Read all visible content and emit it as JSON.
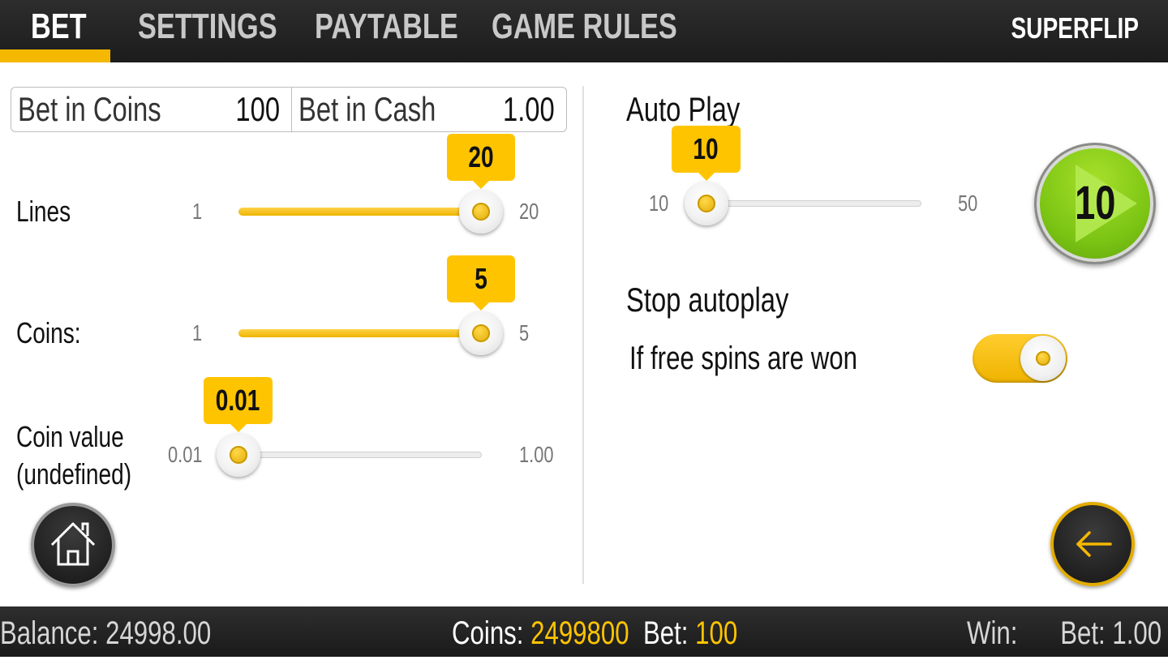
{
  "nav": {
    "tabs": [
      {
        "label": "BET",
        "active": true
      },
      {
        "label": "SETTINGS",
        "active": false
      },
      {
        "label": "PAYTABLE",
        "active": false
      },
      {
        "label": "GAME RULES",
        "active": false
      }
    ],
    "brand": "SUPERFLIP"
  },
  "bet_box": {
    "coins_label": "Bet in Coins",
    "coins_value": "100",
    "cash_label": "Bet in Cash",
    "cash_value": "1.00"
  },
  "sliders": {
    "lines": {
      "label": "Lines",
      "min": "1",
      "max": "20",
      "value": "20",
      "fraction": 1.0
    },
    "coins": {
      "label": "Coins:",
      "min": "1",
      "max": "5",
      "value": "5",
      "fraction": 1.0
    },
    "coin_value": {
      "label_line1": "Coin value",
      "label_line2": "(undefined)",
      "min": "0.01",
      "max": "1.00",
      "value": "0.01",
      "fraction": 0.0
    }
  },
  "autoplay": {
    "title": "Auto Play",
    "min": "10",
    "max": "50",
    "value": "10",
    "fraction": 0.0,
    "play_count": "10"
  },
  "stop_autoplay": {
    "title": "Stop autoplay",
    "option_label": "If free spins are won",
    "option_on": true
  },
  "bottom": {
    "balance_label": "Balance:",
    "balance_value": "24998.00",
    "coins_label": "Coins:",
    "coins_value": "2499800",
    "bet_label": "Bet:",
    "bet_value": "100",
    "win_label": "Win:",
    "bet2_label": "Bet:",
    "bet2_value": "1.00"
  },
  "icons": {
    "home": "home-icon",
    "back": "arrow-left-icon",
    "play": "play-icon"
  },
  "colors": {
    "accent": "#ffc400",
    "play_green": "#7cc414",
    "bar_dark": "#1c1c1c"
  }
}
